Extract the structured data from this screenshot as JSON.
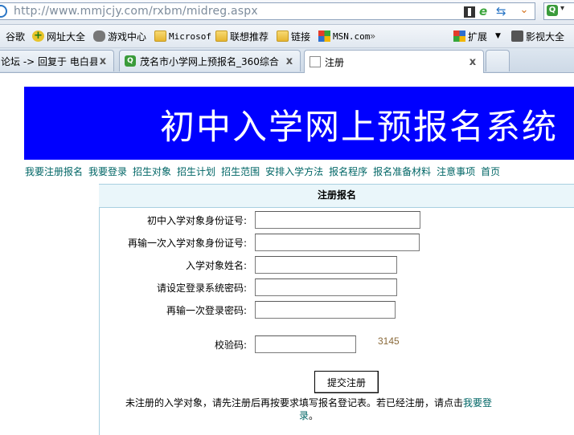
{
  "browser": {
    "url": "http://www.mmjcjy.com/rxbm/midreg.aspx",
    "bookmarks": [
      {
        "label": "谷歌",
        "icon": "google-icon"
      },
      {
        "label": "网址大全",
        "icon": "plus-icon"
      },
      {
        "label": "游戏中心",
        "icon": "gamepad-icon"
      },
      {
        "label": "Microsof",
        "icon": "folder-icon"
      },
      {
        "label": "联想推荐",
        "icon": "folder-icon"
      },
      {
        "label": "链接",
        "icon": "folder-icon"
      },
      {
        "label": "MSN.com",
        "icon": "msn-icon"
      },
      {
        "label": "扩展",
        "icon": "extensions-icon"
      },
      {
        "label": "影视大全",
        "icon": "film-icon"
      }
    ],
    "more_bookmarks": "»",
    "tabs": [
      {
        "label": "论坛 -> 回复于 电白县",
        "close": "x"
      },
      {
        "label": "茂名市小学网上预报名_360综合",
        "close": "x"
      },
      {
        "label": "注册",
        "close": "x"
      }
    ]
  },
  "page": {
    "banner_title": "初中入学网上预报名系统",
    "nav": [
      "我要注册报名",
      "我要登录",
      "招生对象",
      "招生计划",
      "招生范围",
      "安排入学方法",
      "报名程序",
      "报名准备材料",
      "注意事项",
      "首页"
    ],
    "form": {
      "title": "注册报名",
      "fields": {
        "id_number": {
          "label": "初中入学对象身份证号:",
          "value": ""
        },
        "id_confirm": {
          "label": "再输一次入学对象身份证号:",
          "value": ""
        },
        "name": {
          "label": "入学对象姓名:",
          "value": ""
        },
        "password": {
          "label": "请设定登录系统密码:",
          "value": ""
        },
        "password_confirm": {
          "label": "再输一次登录密码:",
          "value": ""
        },
        "captcha": {
          "label": "校验码:",
          "value": ""
        }
      },
      "captcha_code": "3145",
      "submit_label": "提交注册",
      "note_text": "未注册的入学对象，请先注册后再按要求填写报名登记表。若已经注册，请点击",
      "note_link": "我要登录",
      "note_end": "。"
    }
  },
  "colors": {
    "banner_bg": "#0000ff",
    "nav_link": "#006666",
    "form_header_bg": "#eaf6fa"
  }
}
